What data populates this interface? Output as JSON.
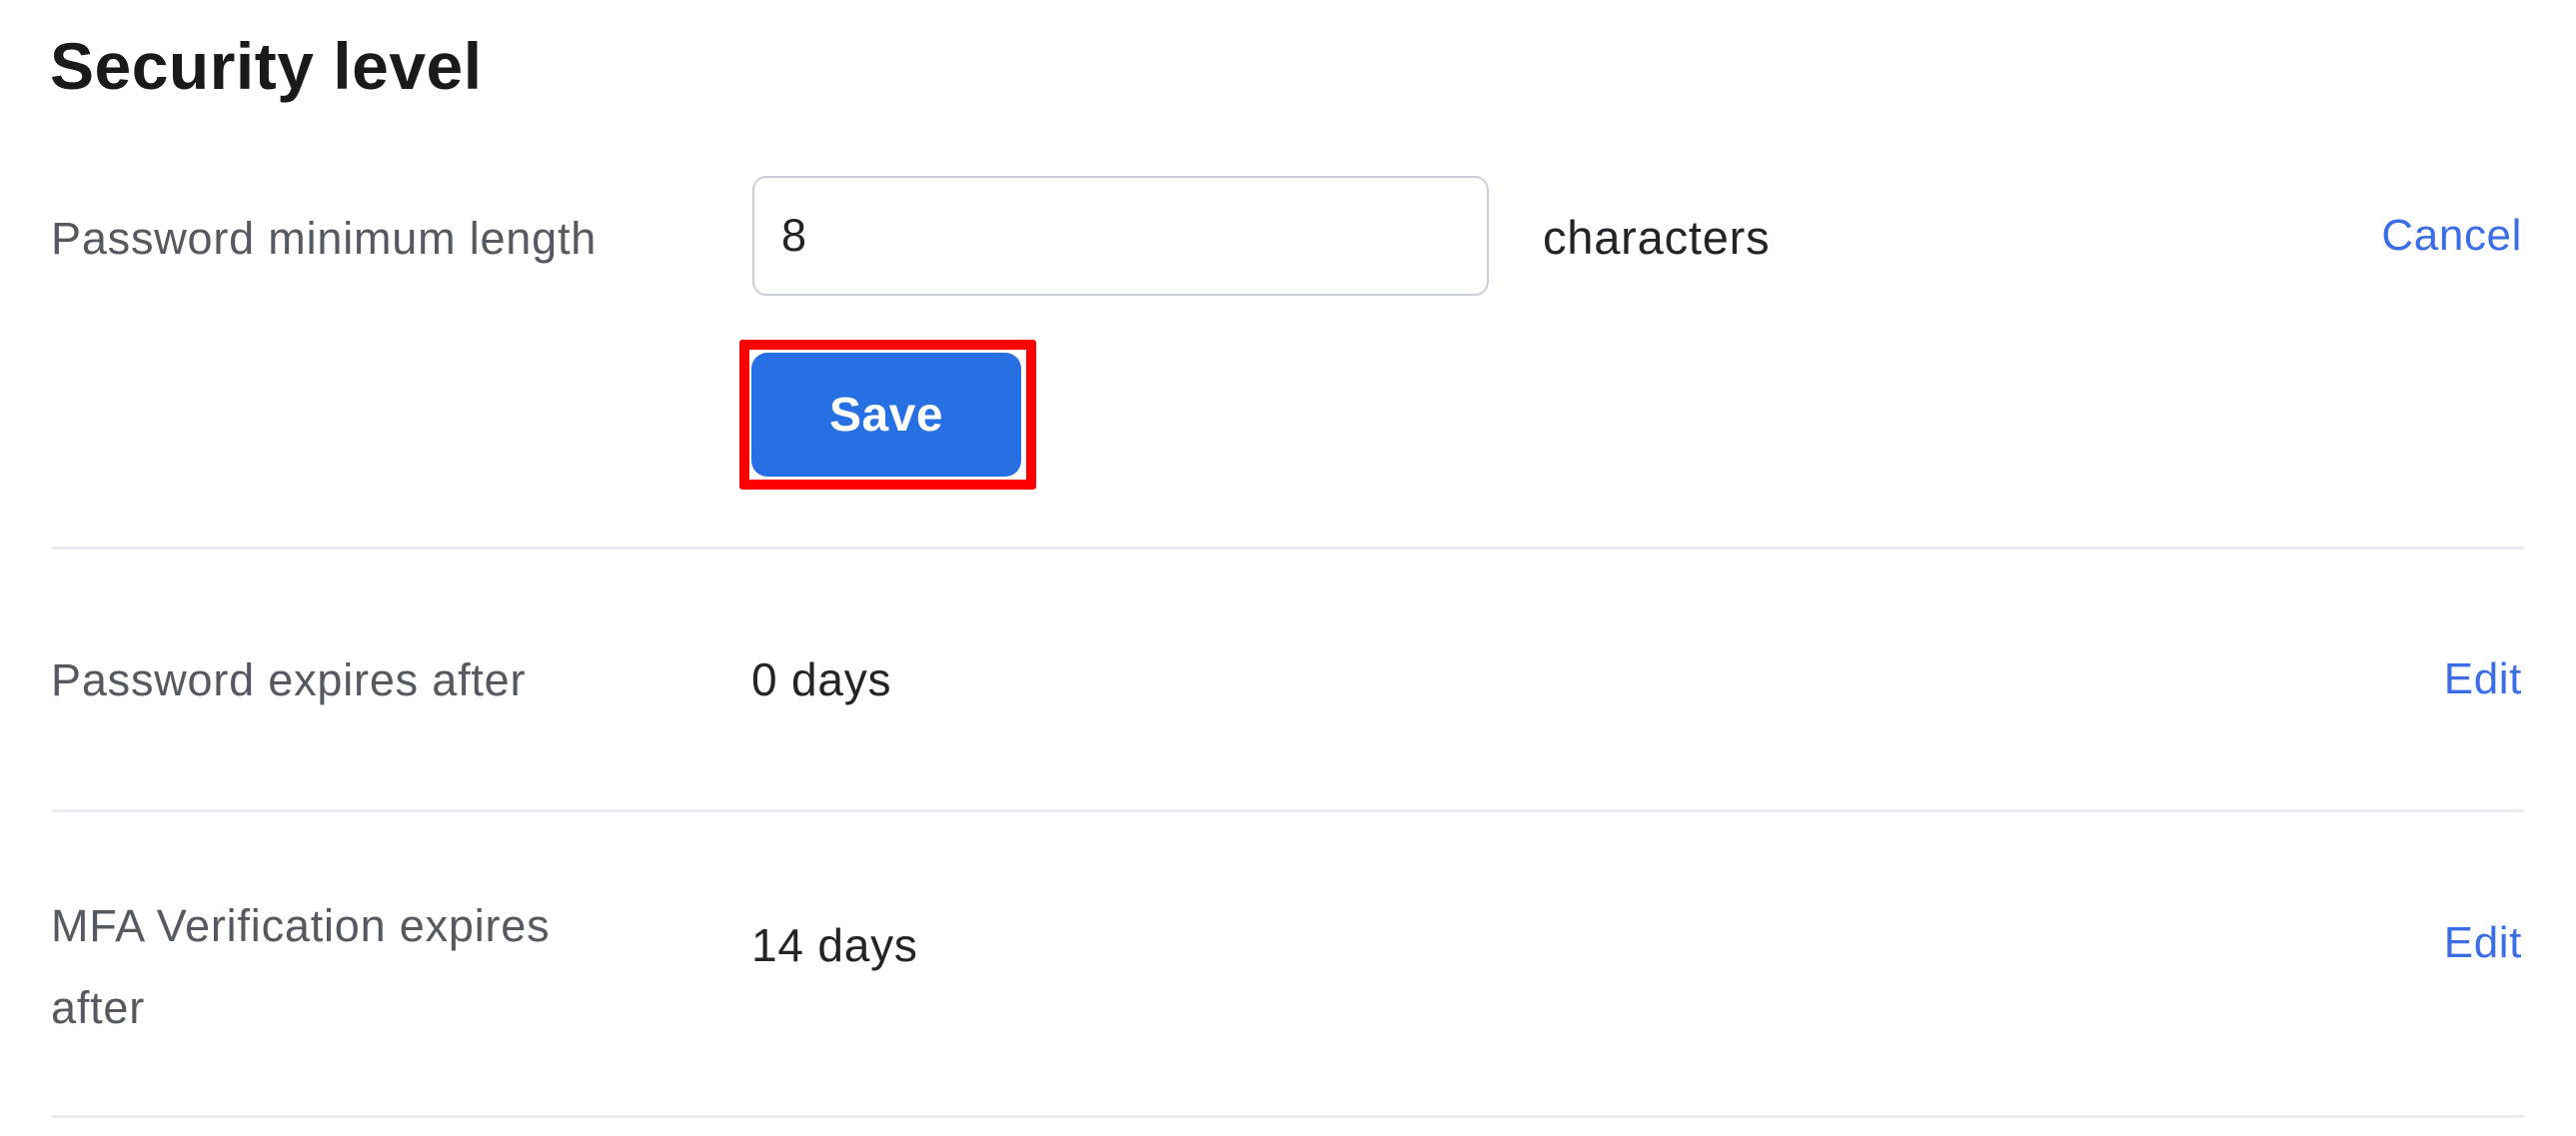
{
  "section": {
    "title": "Security level"
  },
  "colors": {
    "accent_link": "#3b6de6",
    "primary_button": "#2670e3",
    "highlight": "#ff0000"
  },
  "settings": [
    {
      "label": "Password minimum length",
      "editing": true,
      "input_value": "8",
      "unit": "characters",
      "action_label": "Cancel",
      "save_label": "Save"
    },
    {
      "label": "Password expires after",
      "editing": false,
      "value": "0 days",
      "action_label": "Edit"
    },
    {
      "label": "MFA Verification expires after",
      "editing": false,
      "value": "14 days",
      "action_label": "Edit"
    }
  ]
}
